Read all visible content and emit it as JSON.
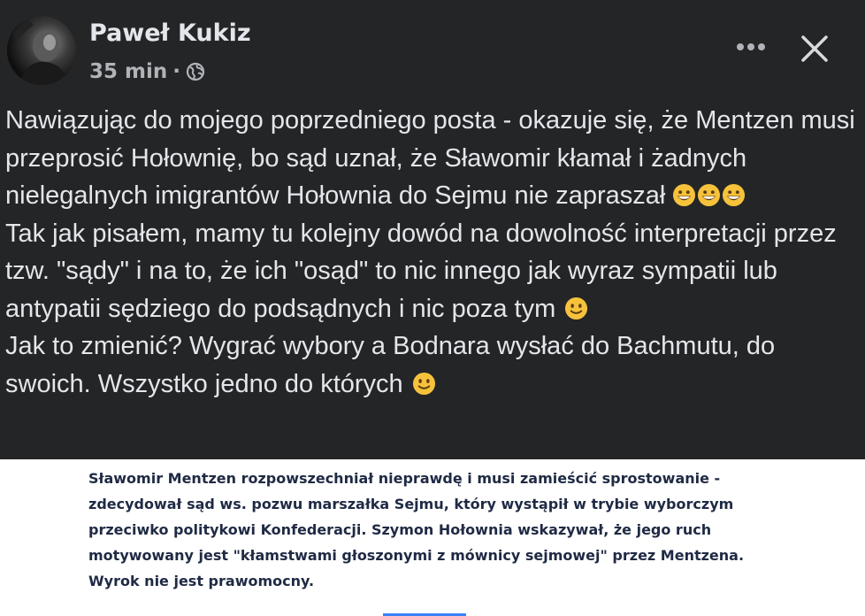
{
  "post": {
    "author": "Paweł Kukiz",
    "time": "35 min",
    "separator": "·",
    "privacy_icon": "globe-icon",
    "actions": {
      "more_icon": "more-horizontal-icon",
      "close_icon": "close-icon"
    },
    "paragraphs": [
      {
        "text": "Nawiązując do mojego poprzedniego posta - okazuje się, że Mentzen musi przeprosić Hołownię, bo sąd uznał, że Sławomir kłamał i żadnych nielegalnych imigrantów Hołownia do Sejmu nie zapraszał",
        "emojis": [
          "grinning-face-icon",
          "grinning-face-icon",
          "grinning-face-icon"
        ]
      },
      {
        "text": "Tak jak pisałem, mamy tu kolejny dowód na dowolność interpretacji przez tzw. \"sądy\" i na to, że  ich \"osąd\" to nic innego jak wyraz sympatii lub antypatii sędziego do podsądnych i nic poza tym",
        "emojis": [
          "slightly-smiling-face-icon"
        ]
      },
      {
        "text": "Jak to zmienić? Wygrać wybory a Bodnara wysłać do Bachmutu, do swoich. Wszystko jedno do których",
        "emojis": [
          "slightly-smiling-face-icon"
        ]
      }
    ]
  },
  "article": {
    "excerpt": "Sławomir Mentzen rozpowszechniał nieprawdę i musi zamieścić sprostowanie - zdecydował sąd ws. pozwu marszałka Sejmu, który wystąpił w trybie wyborczym przeciwko politykowi Konfederacji. Szymon Hołownia wskazywał, że jego ruch motywowany jest \"kłamstwami głoszonymi z mównicy sejmowej\" przez Mentzena. Wyrok nie jest prawomocny."
  },
  "colors": {
    "background": "#242526",
    "text_primary": "#e4e6eb",
    "text_secondary": "#b0b3b8",
    "article_text": "#1f2a44",
    "accent": "#3b82f6"
  }
}
